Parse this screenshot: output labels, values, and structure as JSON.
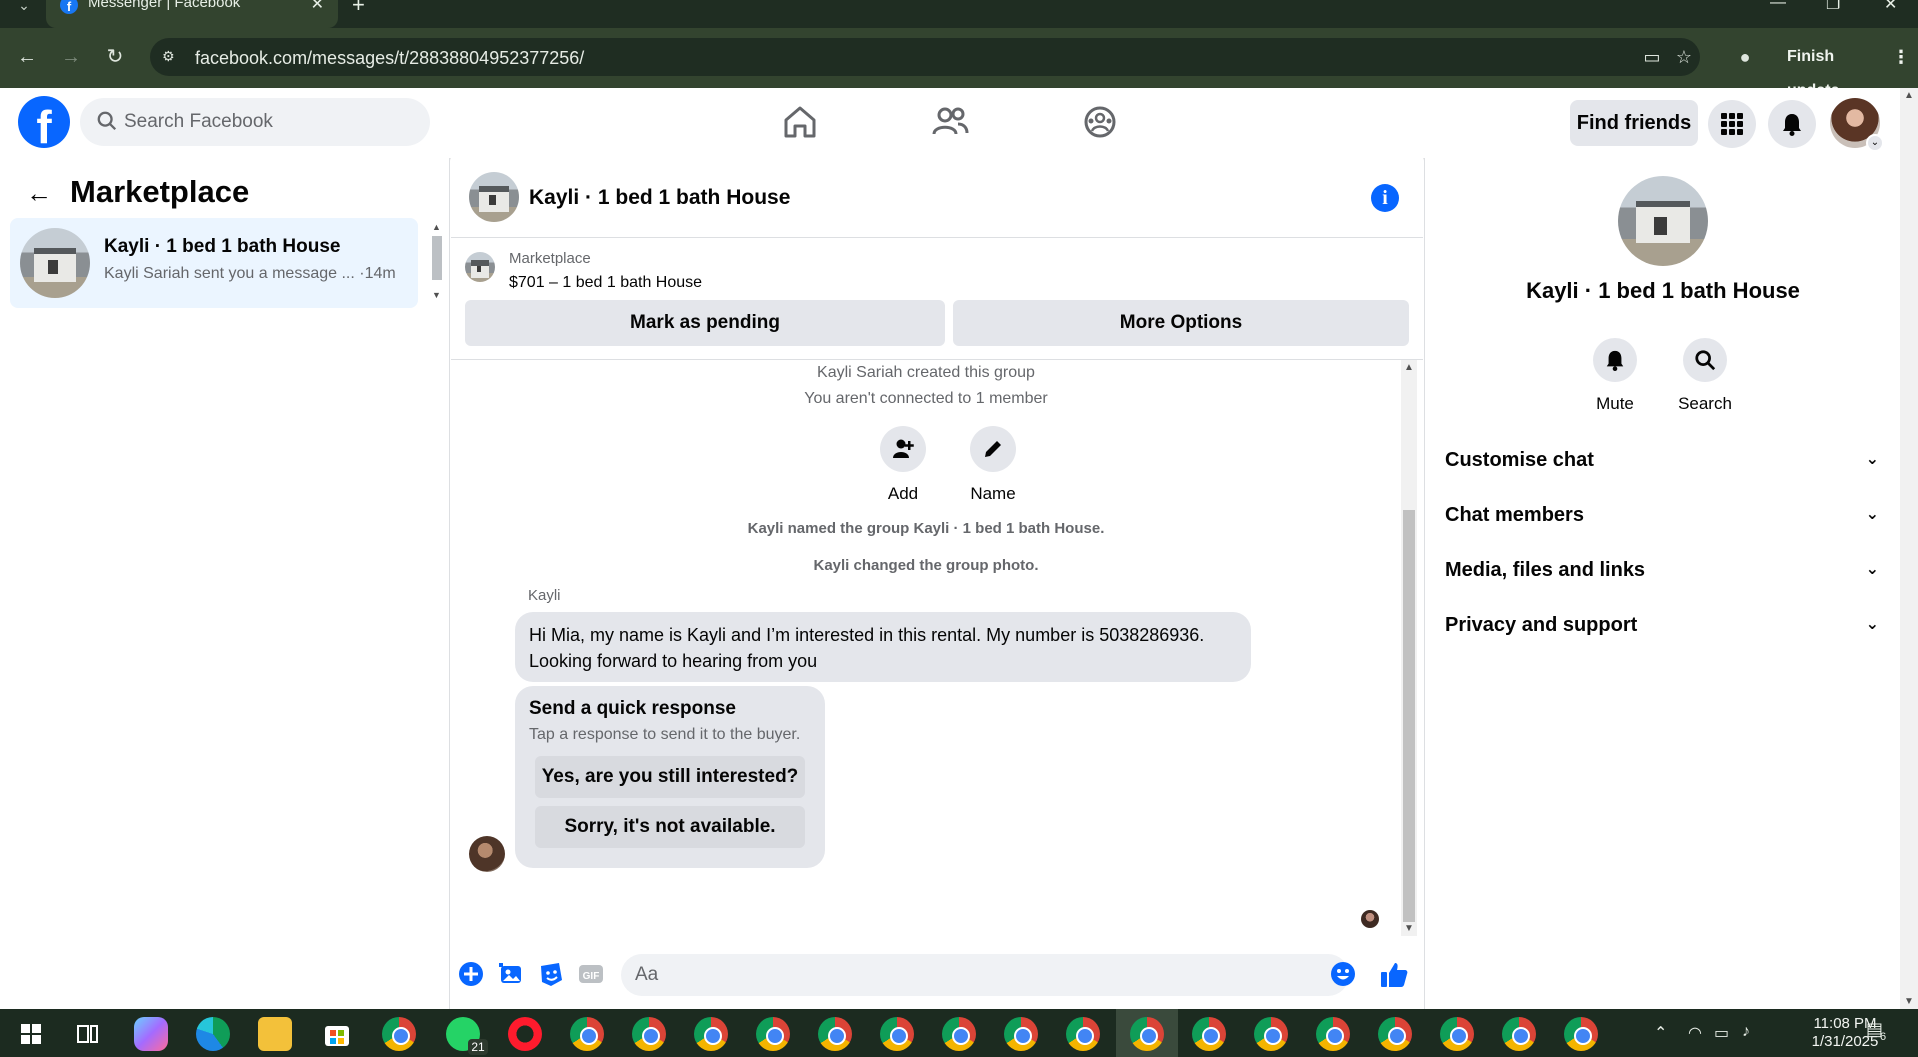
{
  "browser": {
    "tab_title": "Messenger | Facebook",
    "url": "facebook.com/messages/t/28838804952377256/",
    "finish_update": "Finish update"
  },
  "fb_header": {
    "search_placeholder": "Search Facebook",
    "find_friends": "Find friends"
  },
  "left": {
    "title": "Marketplace",
    "conversation": {
      "name": "Kayli · 1 bed 1 bath House",
      "snippet": "Kayli Sariah sent you a message ... ·14m"
    }
  },
  "chat": {
    "header_name": "Kayli · 1 bed 1 bath House",
    "listing_label": "Marketplace",
    "listing_price": "$701 – 1 bed 1 bath House",
    "mark_pending": "Mark as pending",
    "more_options": "More Options",
    "created_notice": "Kayli Sariah created this group",
    "connected_notice": "You aren't connected to 1 member",
    "add_label": "Add",
    "name_label": "Name",
    "named_notice": "Kayli named the group Kayli · 1 bed 1 bath House.",
    "photo_notice": "Kayli changed the group photo.",
    "sender": "Kayli",
    "message_line1": "Hi Mia, my name is Kayli and I’m interested in this rental. My number is 5038286936.",
    "message_line2": "Looking forward to hearing from you",
    "quick_title": "Send a quick response",
    "quick_sub": "Tap a response to send it to the buyer.",
    "quick_reply_1": "Yes, are you still interested?",
    "quick_reply_2": "Sorry, it's not available.",
    "composer_placeholder": "Aa"
  },
  "right": {
    "name": "Kayli · 1 bed 1 bath House",
    "mute": "Mute",
    "search": "Search",
    "sections": [
      "Customise chat",
      "Chat members",
      "Media, files and links",
      "Privacy and support"
    ]
  },
  "taskbar": {
    "time": "11:08 PM",
    "date": "1/31/2025",
    "whatsapp_badge": "21",
    "notification_count": "6"
  },
  "colors": {
    "fb_blue": "#0866ff",
    "selected_conv_bg": "#ebf5ff",
    "bubble_gray": "#e4e6eb",
    "chrome_green": "#33442f"
  }
}
